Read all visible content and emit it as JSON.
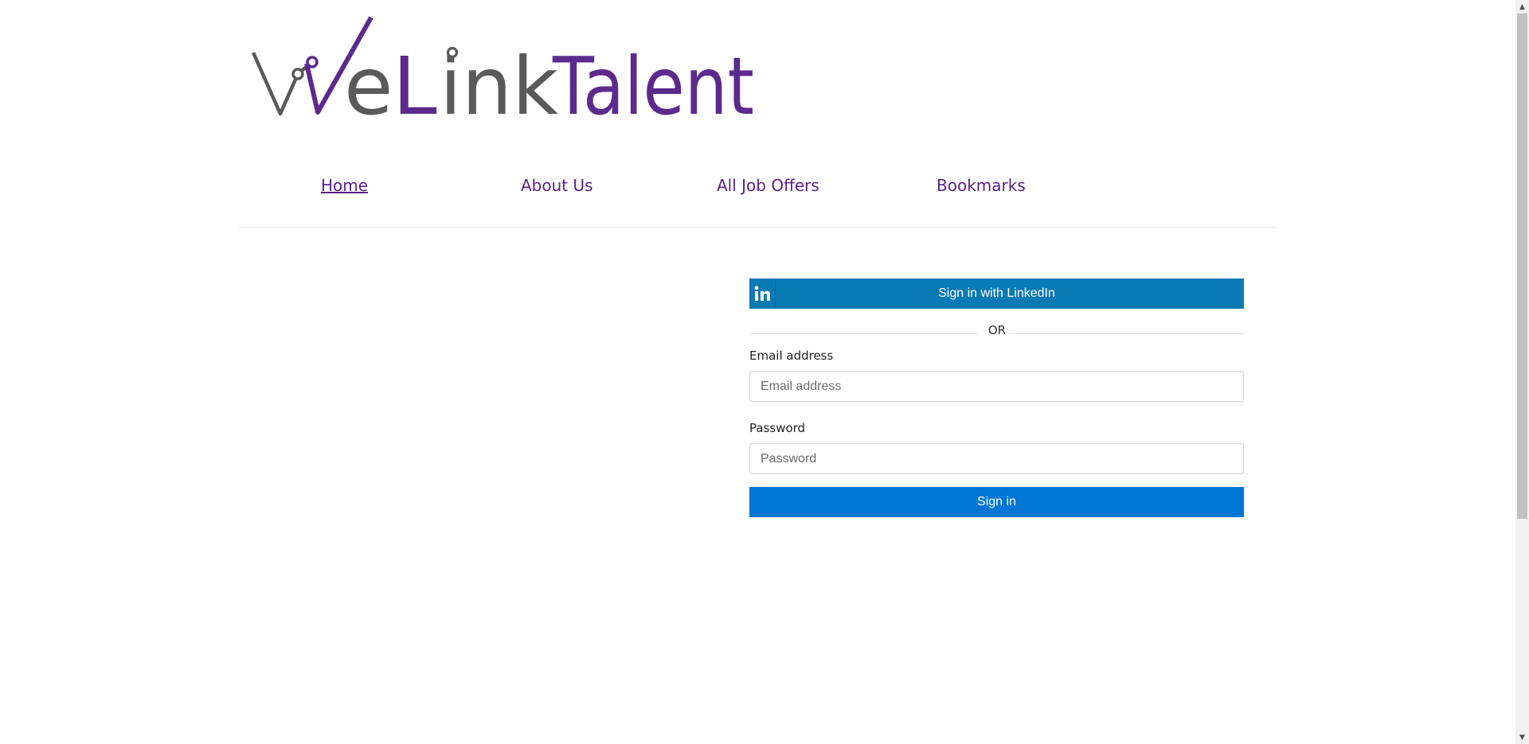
{
  "header": {
    "logo_text": "WeLinkTalent",
    "logo_colors": {
      "grey": "#5a5a5a",
      "purple": "#5c2a8c"
    }
  },
  "nav": {
    "items": [
      {
        "label": "Home",
        "active": true
      },
      {
        "label": "About Us",
        "active": false
      },
      {
        "label": "All Job Offers",
        "active": false
      },
      {
        "label": "Bookmarks",
        "active": false
      }
    ],
    "color": "#5a1f86"
  },
  "login": {
    "linkedin_label": "Sign in with LinkedIn",
    "linkedin_icon": "linkedin-icon",
    "or_text": "OR",
    "email_label": "Email address",
    "email_placeholder": "Email address",
    "email_value": "",
    "password_label": "Password",
    "password_placeholder": "Password",
    "password_value": "",
    "signin_label": "Sign in",
    "linkedin_color": "#0a7ab5",
    "signin_color": "#0076d6"
  },
  "scrollbar": {
    "up_icon": "scroll-up-arrow-icon",
    "down_icon": "scroll-down-arrow-icon"
  }
}
